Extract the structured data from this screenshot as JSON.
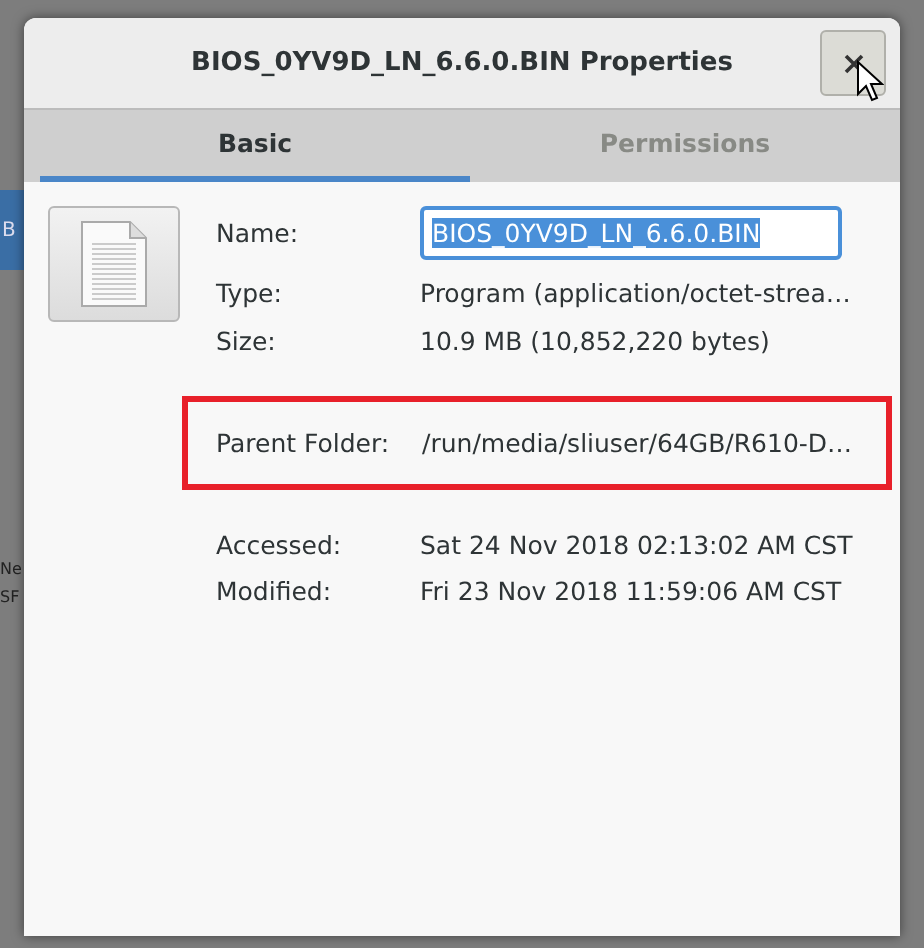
{
  "background_fragments": [
    {
      "text": "B",
      "kind": "tile"
    },
    {
      "text": "Ne",
      "kind": "label"
    },
    {
      "text": "SF",
      "kind": "label"
    }
  ],
  "window": {
    "title": "BIOS_0YV9D_LN_6.6.0.BIN Properties"
  },
  "tabs": [
    {
      "label": "Basic",
      "selected": true
    },
    {
      "label": "Permissions",
      "selected": false
    }
  ],
  "name_field": {
    "label": "Name:",
    "value": "BIOS_0YV9D_LN_6.6.0.BIN",
    "text_selected": true
  },
  "info_rows": [
    {
      "label": "Type:",
      "value": "Program (application/octet-strea…"
    },
    {
      "label": "Size:",
      "value": "10.9 MB (10,852,220 bytes)"
    }
  ],
  "highlighted_row": {
    "label": "Parent Folder:",
    "value": "/run/media/sliuser/64GB/R610-D…"
  },
  "date_rows": [
    {
      "label": "Accessed:",
      "value": "Sat 24 Nov 2018 02:13:02 AM CST"
    },
    {
      "label": "Modified:",
      "value": "Fri 23 Nov 2018 11:59:06 AM CST"
    }
  ]
}
